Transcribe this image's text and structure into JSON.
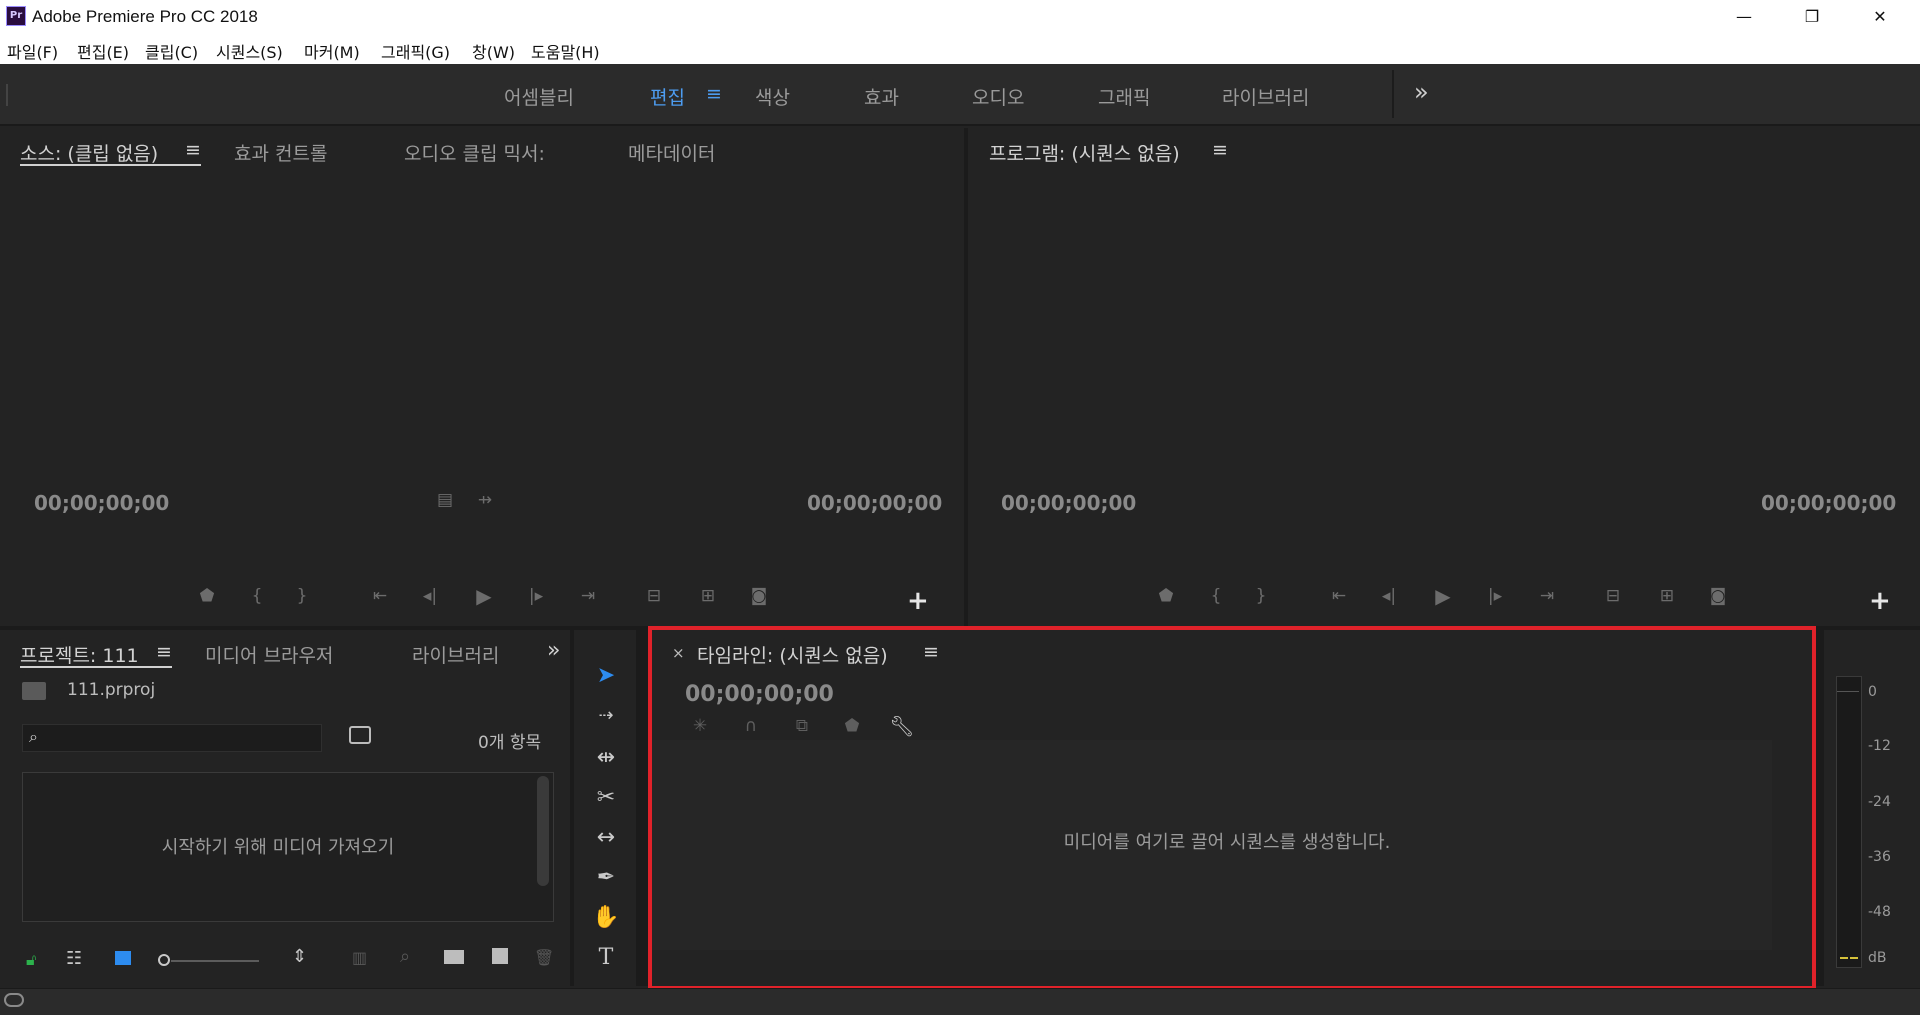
{
  "window": {
    "title": "Adobe Premiere Pro CC 2018",
    "logo_text": "Pr",
    "controls": {
      "minimize": "—",
      "restore": "❐",
      "close": "✕"
    }
  },
  "menu": [
    "파일(F)",
    "편집(E)",
    "클립(C)",
    "시퀀스(S)",
    "마커(M)",
    "그래픽(G)",
    "창(W)",
    "도움말(H)"
  ],
  "workspaces": {
    "tabs": [
      "어셈블리",
      "편집",
      "색상",
      "효과",
      "오디오",
      "그래픽",
      "라이브러리"
    ],
    "active": "편집",
    "menu_icon": "≡",
    "overflow": "»"
  },
  "source_panel": {
    "tabs": [
      "소스: (클립 없음)",
      "효과 컨트롤",
      "오디오 클립 믹서:",
      "메타데이터"
    ],
    "menu_icon": "≡",
    "timecode_left": "00;00;00;00",
    "timecode_right": "00;00;00;00",
    "add_button": "+"
  },
  "program_panel": {
    "tab": "프로그램: (시퀀스 없음)",
    "menu_icon": "≡",
    "timecode_left": "00;00;00;00",
    "timecode_right": "00;00;00;00",
    "add_button": "+"
  },
  "project_panel": {
    "tabs": [
      "프로젝트: 111",
      "미디어 브라우저",
      "라이브러리"
    ],
    "menu_icon": "≡",
    "overflow": "»",
    "project_file": "111.prproj",
    "search_placeholder": "",
    "item_count": "0개 항목",
    "empty_message": "시작하기 위해 미디어 가져오기"
  },
  "timeline_panel": {
    "close": "×",
    "tab": "타임라인: (시퀀스 없음)",
    "menu_icon": "≡",
    "timecode": "00;00;00;00",
    "empty_message": "미디어를 여기로 끌어 시퀀스를 생성합니다.",
    "highlight_color": "#e0222a"
  },
  "audio_meter": {
    "ticks": [
      "0",
      "-12",
      "-24",
      "-36",
      "-48",
      "dB"
    ]
  },
  "colors": {
    "accent": "#4d9cf0",
    "background": "#232323",
    "highlight": "#e0222a"
  }
}
